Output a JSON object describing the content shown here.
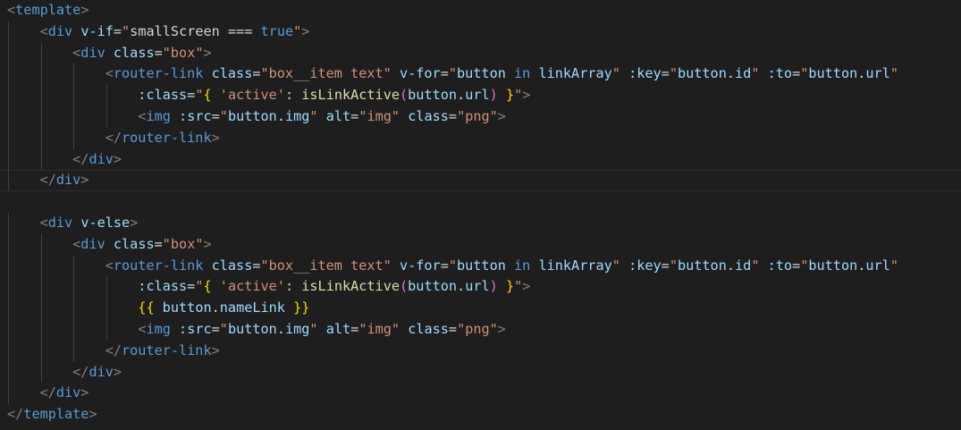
{
  "editor": {
    "language": "vue",
    "lines": [
      {
        "indent": 0,
        "tokens": [
          [
            "bracket",
            "<"
          ],
          [
            "tag",
            "template"
          ],
          [
            "bracket",
            ">"
          ]
        ]
      },
      {
        "indent": 1,
        "tokens": [
          [
            "bracket",
            "<"
          ],
          [
            "tag",
            "div"
          ],
          [
            "plain",
            " "
          ],
          [
            "attr",
            "v-if"
          ],
          [
            "eq",
            "="
          ],
          [
            "str",
            "\""
          ],
          [
            "plain",
            "smallScreen "
          ],
          [
            "punct",
            "==="
          ],
          [
            "plain",
            " "
          ],
          [
            "keyword",
            "true"
          ],
          [
            "str",
            "\""
          ],
          [
            "bracket",
            ">"
          ]
        ]
      },
      {
        "indent": 2,
        "tokens": [
          [
            "bracket",
            "<"
          ],
          [
            "tag",
            "div"
          ],
          [
            "plain",
            " "
          ],
          [
            "attr",
            "class"
          ],
          [
            "eq",
            "="
          ],
          [
            "str",
            "\"box\""
          ],
          [
            "bracket",
            ">"
          ]
        ]
      },
      {
        "indent": 3,
        "tokens": [
          [
            "bracket",
            "<"
          ],
          [
            "tag",
            "router-link"
          ],
          [
            "plain",
            " "
          ],
          [
            "attr",
            "class"
          ],
          [
            "eq",
            "="
          ],
          [
            "str",
            "\"box__item text\""
          ],
          [
            "plain",
            " "
          ],
          [
            "attr",
            "v-for"
          ],
          [
            "eq",
            "="
          ],
          [
            "str",
            "\""
          ],
          [
            "var",
            "button"
          ],
          [
            "plain",
            " "
          ],
          [
            "kw-in",
            "in"
          ],
          [
            "plain",
            " "
          ],
          [
            "var",
            "linkArray"
          ],
          [
            "str",
            "\""
          ],
          [
            "plain",
            " "
          ],
          [
            "attr",
            ":key"
          ],
          [
            "eq",
            "="
          ],
          [
            "str",
            "\""
          ],
          [
            "var",
            "button"
          ],
          [
            "punct",
            "."
          ],
          [
            "var",
            "id"
          ],
          [
            "str",
            "\""
          ],
          [
            "plain",
            " "
          ],
          [
            "attr",
            ":to"
          ],
          [
            "eq",
            "="
          ],
          [
            "str",
            "\""
          ],
          [
            "var",
            "button"
          ],
          [
            "punct",
            "."
          ],
          [
            "var",
            "url"
          ],
          [
            "str",
            "\""
          ]
        ]
      },
      {
        "indent": 4,
        "tokens": [
          [
            "attr",
            ":class"
          ],
          [
            "eq",
            "="
          ],
          [
            "str",
            "\""
          ],
          [
            "brace",
            "{"
          ],
          [
            "plain",
            " "
          ],
          [
            "str",
            "'active'"
          ],
          [
            "punct",
            ":"
          ],
          [
            "plain",
            " "
          ],
          [
            "fn",
            "isLinkActive"
          ],
          [
            "paren",
            "("
          ],
          [
            "var",
            "button"
          ],
          [
            "punct",
            "."
          ],
          [
            "var",
            "url"
          ],
          [
            "paren",
            ")"
          ],
          [
            "plain",
            " "
          ],
          [
            "brace",
            "}"
          ],
          [
            "str",
            "\""
          ],
          [
            "bracket",
            ">"
          ]
        ]
      },
      {
        "indent": 4,
        "tokens": [
          [
            "bracket",
            "<"
          ],
          [
            "tag",
            "img"
          ],
          [
            "plain",
            " "
          ],
          [
            "attr",
            ":src"
          ],
          [
            "eq",
            "="
          ],
          [
            "str",
            "\""
          ],
          [
            "var",
            "button"
          ],
          [
            "punct",
            "."
          ],
          [
            "var",
            "img"
          ],
          [
            "str",
            "\""
          ],
          [
            "plain",
            " "
          ],
          [
            "attr",
            "alt"
          ],
          [
            "eq",
            "="
          ],
          [
            "str",
            "\"img\""
          ],
          [
            "plain",
            " "
          ],
          [
            "attr",
            "class"
          ],
          [
            "eq",
            "="
          ],
          [
            "str",
            "\"png\""
          ],
          [
            "bracket",
            ">"
          ]
        ]
      },
      {
        "indent": 3,
        "tokens": [
          [
            "bracket",
            "</"
          ],
          [
            "tag",
            "router-link"
          ],
          [
            "bracket",
            ">"
          ]
        ]
      },
      {
        "indent": 2,
        "tokens": [
          [
            "bracket",
            "</"
          ],
          [
            "tag",
            "div"
          ],
          [
            "bracket",
            ">"
          ]
        ]
      },
      {
        "indent": 1,
        "current": true,
        "tokens": [
          [
            "bracket",
            "</"
          ],
          [
            "tag",
            "div"
          ],
          [
            "bracket",
            ">"
          ]
        ]
      },
      {
        "indent": 0,
        "tokens": []
      },
      {
        "indent": 1,
        "tokens": [
          [
            "bracket",
            "<"
          ],
          [
            "tag",
            "div"
          ],
          [
            "plain",
            " "
          ],
          [
            "attr",
            "v-else"
          ],
          [
            "bracket",
            ">"
          ]
        ]
      },
      {
        "indent": 2,
        "tokens": [
          [
            "bracket",
            "<"
          ],
          [
            "tag",
            "div"
          ],
          [
            "plain",
            " "
          ],
          [
            "attr",
            "class"
          ],
          [
            "eq",
            "="
          ],
          [
            "str",
            "\"box\""
          ],
          [
            "bracket",
            ">"
          ]
        ]
      },
      {
        "indent": 3,
        "tokens": [
          [
            "bracket",
            "<"
          ],
          [
            "tag",
            "router-link"
          ],
          [
            "plain",
            " "
          ],
          [
            "attr",
            "class"
          ],
          [
            "eq",
            "="
          ],
          [
            "str",
            "\"box__item text\""
          ],
          [
            "plain",
            " "
          ],
          [
            "attr",
            "v-for"
          ],
          [
            "eq",
            "="
          ],
          [
            "str",
            "\""
          ],
          [
            "var",
            "button"
          ],
          [
            "plain",
            " "
          ],
          [
            "kw-in",
            "in"
          ],
          [
            "plain",
            " "
          ],
          [
            "var",
            "linkArray"
          ],
          [
            "str",
            "\""
          ],
          [
            "plain",
            " "
          ],
          [
            "attr",
            ":key"
          ],
          [
            "eq",
            "="
          ],
          [
            "str",
            "\""
          ],
          [
            "var",
            "button"
          ],
          [
            "punct",
            "."
          ],
          [
            "var",
            "id"
          ],
          [
            "str",
            "\""
          ],
          [
            "plain",
            " "
          ],
          [
            "attr",
            ":to"
          ],
          [
            "eq",
            "="
          ],
          [
            "str",
            "\""
          ],
          [
            "var",
            "button"
          ],
          [
            "punct",
            "."
          ],
          [
            "var",
            "url"
          ],
          [
            "str",
            "\""
          ]
        ]
      },
      {
        "indent": 4,
        "tokens": [
          [
            "attr",
            ":class"
          ],
          [
            "eq",
            "="
          ],
          [
            "str",
            "\""
          ],
          [
            "brace",
            "{"
          ],
          [
            "plain",
            " "
          ],
          [
            "str",
            "'active'"
          ],
          [
            "punct",
            ":"
          ],
          [
            "plain",
            " "
          ],
          [
            "fn",
            "isLinkActive"
          ],
          [
            "paren",
            "("
          ],
          [
            "var",
            "button"
          ],
          [
            "punct",
            "."
          ],
          [
            "var",
            "url"
          ],
          [
            "paren",
            ")"
          ],
          [
            "plain",
            " "
          ],
          [
            "brace",
            "}"
          ],
          [
            "str",
            "\""
          ],
          [
            "bracket",
            ">"
          ]
        ]
      },
      {
        "indent": 4,
        "tokens": [
          [
            "brace",
            "{{"
          ],
          [
            "plain",
            " "
          ],
          [
            "var",
            "button"
          ],
          [
            "punct",
            "."
          ],
          [
            "var",
            "nameLink"
          ],
          [
            "plain",
            " "
          ],
          [
            "brace",
            "}}"
          ]
        ]
      },
      {
        "indent": 4,
        "tokens": [
          [
            "bracket",
            "<"
          ],
          [
            "tag",
            "img"
          ],
          [
            "plain",
            " "
          ],
          [
            "attr",
            ":src"
          ],
          [
            "eq",
            "="
          ],
          [
            "str",
            "\""
          ],
          [
            "var",
            "button"
          ],
          [
            "punct",
            "."
          ],
          [
            "var",
            "img"
          ],
          [
            "str",
            "\""
          ],
          [
            "plain",
            " "
          ],
          [
            "attr",
            "alt"
          ],
          [
            "eq",
            "="
          ],
          [
            "str",
            "\"img\""
          ],
          [
            "plain",
            " "
          ],
          [
            "attr",
            "class"
          ],
          [
            "eq",
            "="
          ],
          [
            "str",
            "\"png\""
          ],
          [
            "bracket",
            ">"
          ]
        ]
      },
      {
        "indent": 3,
        "tokens": [
          [
            "bracket",
            "</"
          ],
          [
            "tag",
            "router-link"
          ],
          [
            "bracket",
            ">"
          ]
        ]
      },
      {
        "indent": 2,
        "tokens": [
          [
            "bracket",
            "</"
          ],
          [
            "tag",
            "div"
          ],
          [
            "bracket",
            ">"
          ]
        ]
      },
      {
        "indent": 1,
        "tokens": [
          [
            "bracket",
            "</"
          ],
          [
            "tag",
            "div"
          ],
          [
            "bracket",
            ">"
          ]
        ]
      },
      {
        "indent": 0,
        "tokens": [
          [
            "bracket",
            "</"
          ],
          [
            "tag",
            "template"
          ],
          [
            "bracket",
            ">"
          ]
        ]
      }
    ]
  }
}
